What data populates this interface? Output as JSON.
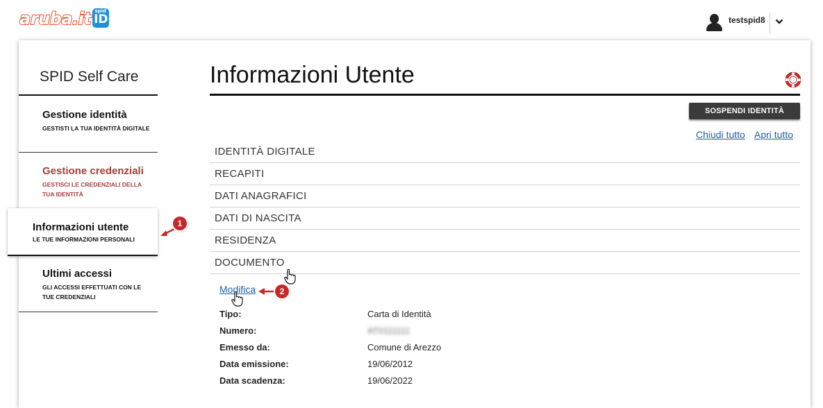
{
  "header": {
    "logo_word": "aruba.it",
    "logo_badge_top": "spid",
    "logo_badge": "ID",
    "username": "testspid8"
  },
  "sidebar": {
    "title": "SPID Self Care",
    "items": [
      {
        "label": "Gestione identità",
        "sub": "GESTISTI LA TUA IDENTITÀ DIGITALE"
      },
      {
        "label": "Gestione credenziali",
        "sub": "GESTISCI LE CREDENZIALI DELLA TUA IDENTITÀ"
      },
      {
        "label": "Informazioni utente",
        "sub": "LE TUE INFORMAZIONI PERSONALI"
      },
      {
        "label": "Ultimi accessi",
        "sub": "GLI ACCESSI EFFETTUATI CON LE TUE CREDENZIALI"
      }
    ]
  },
  "main": {
    "title": "Informazioni Utente",
    "suspend_button": "SOSPENDI IDENTITÀ",
    "collapse_all": "Chiudi tutto",
    "expand_all": "Apri tutto",
    "sections": [
      "IDENTITÀ DIGITALE",
      "RECAPITI",
      "DATI ANAGRAFICI",
      "DATI DI NASCITA",
      "RESIDENZA",
      "DOCUMENTO"
    ],
    "edit_link": "Modifica",
    "document": [
      {
        "label": "Tipo:",
        "value": "Carta di Identità"
      },
      {
        "label": "Numero:",
        "value": "AT0111111"
      },
      {
        "label": "Emesso da:",
        "value": "Comune di Arezzo"
      },
      {
        "label": "Data emissione:",
        "value": "19/06/2012"
      },
      {
        "label": "Data scadenza:",
        "value": "19/06/2022"
      }
    ]
  },
  "annotations": {
    "badge1": "1",
    "badge2": "2"
  },
  "colors": {
    "accent_red": "#a63d3d",
    "link": "#1f5f9e",
    "button": "#3b3b3b",
    "badge": "#c62828",
    "spid_blue": "#1f8fd8",
    "aruba_orange": "#e4572e"
  },
  "icons": [
    "user-icon",
    "chevron-down-icon",
    "lifebuoy-icon",
    "hand-cursor-icon",
    "annotation-arrow-icon"
  ]
}
